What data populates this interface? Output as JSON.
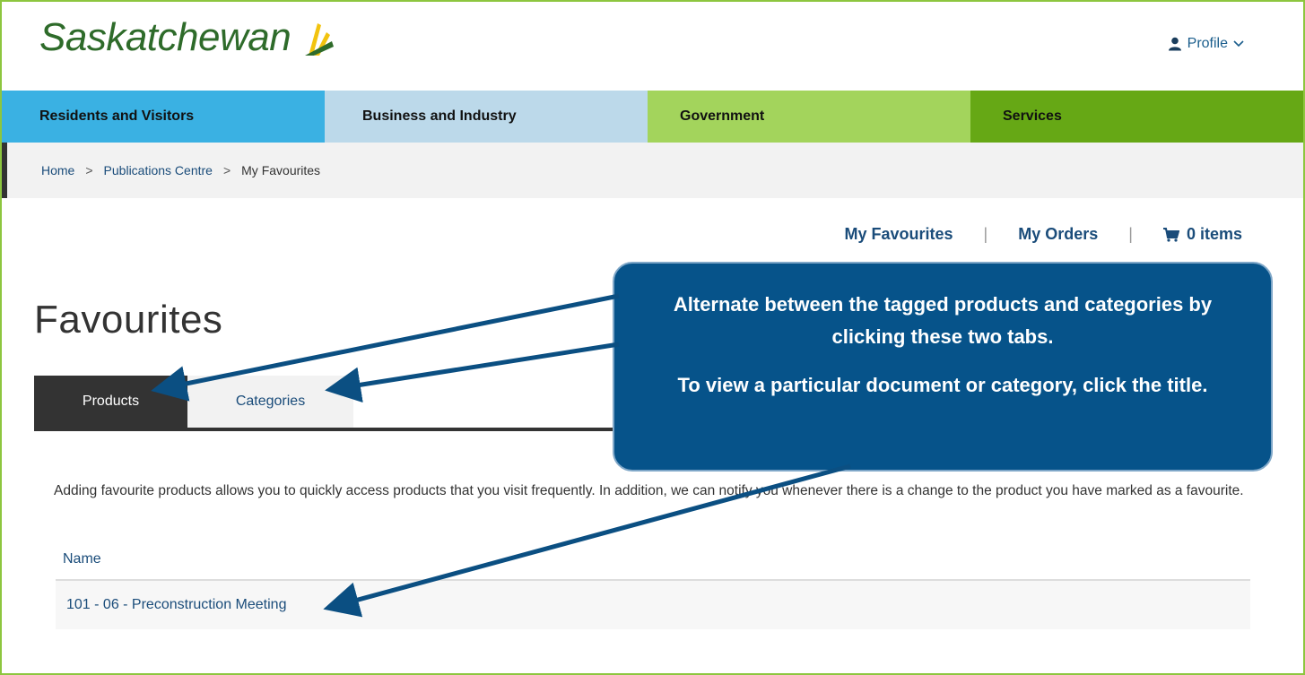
{
  "header": {
    "logo_text": "Saskatchewan",
    "profile_label": "Profile",
    "brand_colors": {
      "green": "#2e6b2a",
      "yellow": "#f2c30f",
      "accent": "#8dc63f"
    }
  },
  "nav": {
    "items": [
      {
        "label": "Residents and Visitors",
        "color": "#3ab1e3"
      },
      {
        "label": "Business and Industry",
        "color": "#bcd9ea"
      },
      {
        "label": "Government",
        "color": "#a3d45c"
      },
      {
        "label": "Services",
        "color": "#66a815"
      }
    ]
  },
  "breadcrumb": {
    "items": [
      "Home",
      "Publications Centre",
      "My Favourites"
    ],
    "separator": ">"
  },
  "utility": {
    "favourites": "My Favourites",
    "orders": "My Orders",
    "cart": "0 items"
  },
  "page": {
    "title": "Favourites",
    "tabs": [
      {
        "label": "Products",
        "active": true
      },
      {
        "label": "Categories",
        "active": false
      }
    ],
    "description": "Adding favourite products allows you to quickly access products that you visit frequently. In addition, we can notify you whenever there is a change to the product you have marked as a favourite.",
    "table": {
      "column_header": "Name",
      "rows": [
        {
          "name": "101 - 06 - Preconstruction Meeting"
        }
      ]
    }
  },
  "callout": {
    "line1": "Alternate between the tagged products and categories by clicking these two tabs.",
    "line2": "To view a particular document or category, click the title.",
    "color": "#06538a"
  }
}
